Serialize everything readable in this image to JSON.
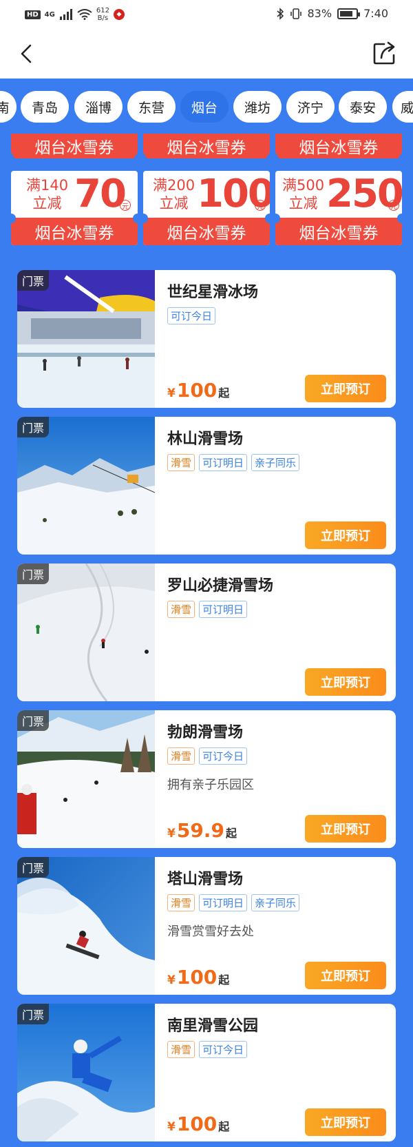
{
  "status_bar": {
    "network": "4G",
    "hd": "HD",
    "speed_value": "612",
    "speed_unit": "B/s",
    "battery": "83%",
    "battery_level": 0.83,
    "time": "7:40"
  },
  "nav": {
    "back_icon": "chevron-left-icon",
    "share_icon": "share-icon"
  },
  "city_tabs": {
    "items": [
      "南",
      "青岛",
      "淄博",
      "东营",
      "烟台",
      "潍坊",
      "济宁",
      "泰安",
      "威"
    ],
    "active": "烟台"
  },
  "coupons": [
    {
      "top": "烟台冰雪券",
      "condition_line1": "满140",
      "condition_line2": "立减",
      "amount": "70",
      "unit": "元",
      "bottom": "烟台冰雪券"
    },
    {
      "top": "烟台冰雪券",
      "condition_line1": "满200",
      "condition_line2": "立减",
      "amount": "100",
      "unit": "元",
      "bottom": "烟台冰雪券"
    },
    {
      "top": "烟台冰雪券",
      "condition_line1": "满500",
      "condition_line2": "立减",
      "amount": "250",
      "unit": "元",
      "bottom": "烟台冰雪券"
    }
  ],
  "venues": [
    {
      "tag": "门票",
      "name": "世纪星滑冰场",
      "labels": [
        {
          "text": "可订今日",
          "color": "blue"
        }
      ],
      "desc": "",
      "price_symbol": "¥",
      "price": "100",
      "price_suffix": "起",
      "button": "立即预订"
    },
    {
      "tag": "门票",
      "name": "林山滑雪场",
      "labels": [
        {
          "text": "滑雪",
          "color": "orange"
        },
        {
          "text": "可订明日",
          "color": "blue"
        },
        {
          "text": "亲子同乐",
          "color": "blue"
        }
      ],
      "desc": "",
      "price_symbol": "",
      "price": "",
      "price_suffix": "",
      "button": "立即预订"
    },
    {
      "tag": "门票",
      "name": "罗山必捷滑雪场",
      "labels": [
        {
          "text": "滑雪",
          "color": "orange"
        },
        {
          "text": "可订明日",
          "color": "blue"
        }
      ],
      "desc": "",
      "price_symbol": "",
      "price": "",
      "price_suffix": "",
      "button": "立即预订"
    },
    {
      "tag": "门票",
      "name": "勃朗滑雪场",
      "labels": [
        {
          "text": "滑雪",
          "color": "orange"
        },
        {
          "text": "可订今日",
          "color": "blue"
        }
      ],
      "desc": "拥有亲子乐园区",
      "price_symbol": "¥",
      "price": "59.9",
      "price_suffix": "起",
      "button": "立即预订"
    },
    {
      "tag": "门票",
      "name": "塔山滑雪场",
      "labels": [
        {
          "text": "滑雪",
          "color": "orange"
        },
        {
          "text": "可订明日",
          "color": "blue"
        },
        {
          "text": "亲子同乐",
          "color": "blue"
        }
      ],
      "desc": "滑雪赏雪好去处",
      "price_symbol": "¥",
      "price": "100",
      "price_suffix": "起",
      "button": "立即预订"
    },
    {
      "tag": "门票",
      "name": "南里滑雪公园",
      "labels": [
        {
          "text": "滑雪",
          "color": "orange"
        },
        {
          "text": "可订今日",
          "color": "blue"
        }
      ],
      "desc": "",
      "price_symbol": "¥",
      "price": "100",
      "price_suffix": "起",
      "button": "立即预订"
    }
  ],
  "colors": {
    "page_background": "#3a7df0",
    "active_tab": "#2f73e8",
    "coupon_red": "#ee4b3e",
    "price_orange": "#f06a18",
    "button_orange": "#fb8c1b"
  }
}
